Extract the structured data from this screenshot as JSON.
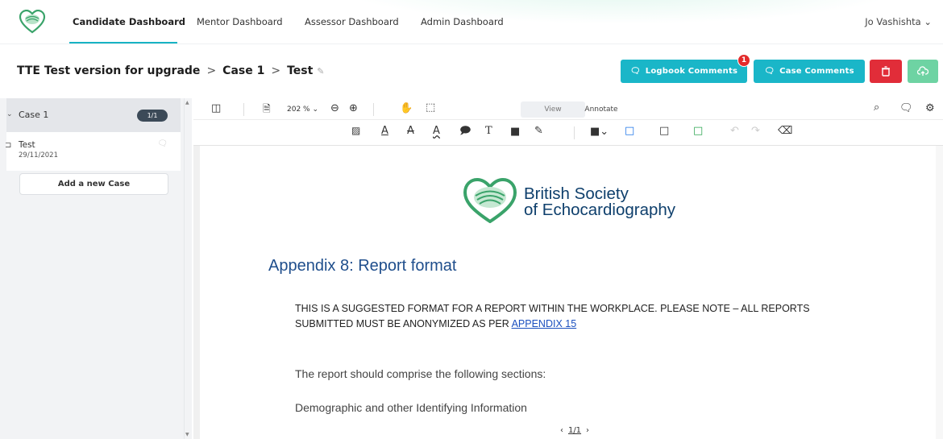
{
  "nav": {
    "tabs": [
      "Candidate Dashboard",
      "Mentor Dashboard",
      "Assessor Dashboard",
      "Admin Dashboard"
    ],
    "active_tab": "Candidate Dashboard",
    "user": "Jo Vashishta ⌄"
  },
  "breadcrumb": {
    "project": "TTE Test version for upgrade",
    "case": "Case 1",
    "item": "Test",
    "separator": ">"
  },
  "actions": {
    "logbook_comments": "Logbook Comments",
    "logbook_badge": "1",
    "case_comments": "Case Comments"
  },
  "sidebar": {
    "case_name": "Case 1",
    "case_count": "1/1",
    "item_name": "Test",
    "item_date": "29/11/2021",
    "add_case": "Add a new Case"
  },
  "viewer": {
    "zoom": "202 %",
    "tab_view": "View",
    "tab_annotate": "Annotate",
    "page_indicator": "1/1"
  },
  "document": {
    "org_line1": "British Society",
    "org_line2": "of Echocardiography",
    "heading": "Appendix 8: Report format",
    "notice_text": "THIS IS A SUGGESTED FORMAT FOR A REPORT WITHIN THE WORKPLACE. PLEASE NOTE – ALL REPORTS SUBMITTED MUST BE ANONYMIZED AS PER ",
    "notice_link": "APPENDIX 15",
    "para1": "The report should comprise the following sections:",
    "para2": "Demographic and other Identifying Information"
  },
  "colors": {
    "accent": "#1ab6c8",
    "danger": "#e12d39",
    "success": "#6ed3a3",
    "brand_navy": "#0e3f6c",
    "brand_green": "#3aa36a"
  }
}
